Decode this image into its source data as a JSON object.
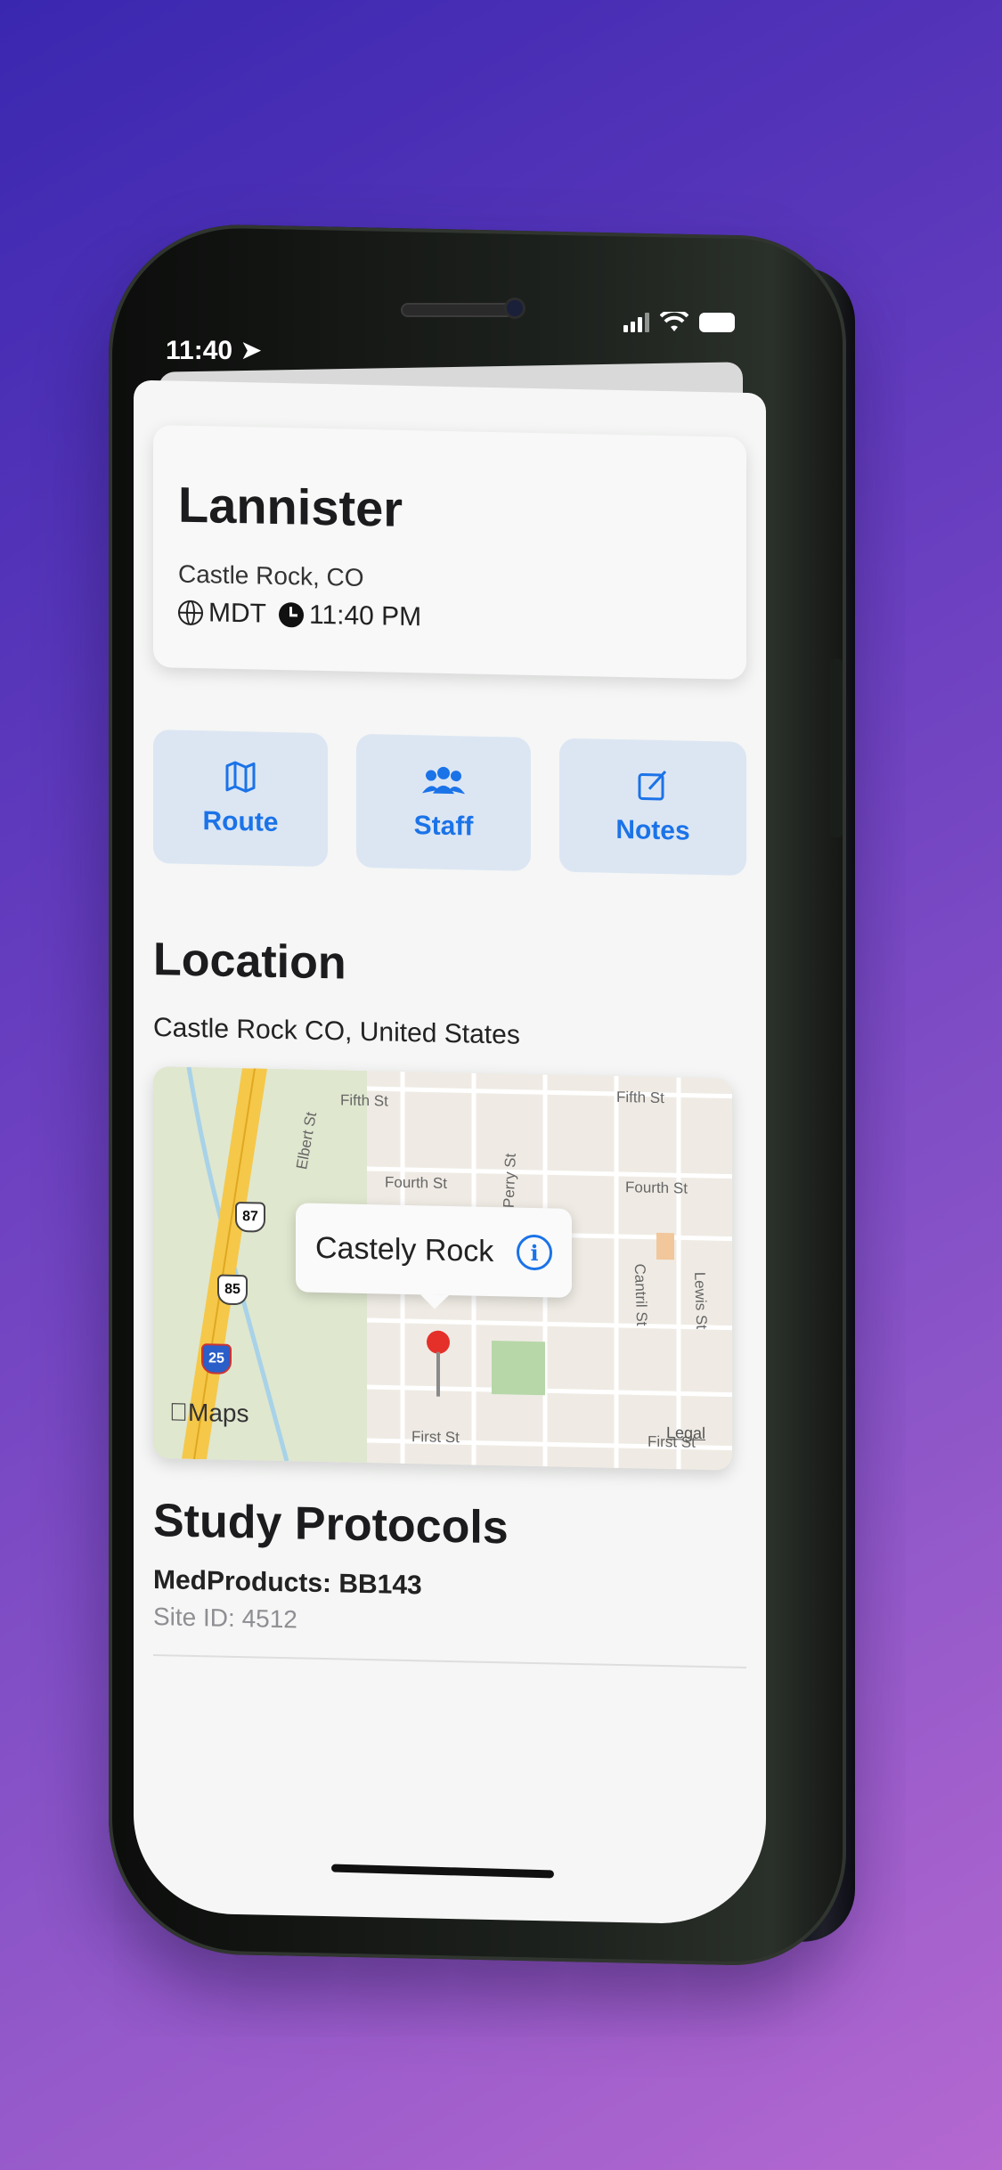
{
  "status_bar": {
    "time": "11:40"
  },
  "header": {
    "title": "Lannister",
    "city": "Castle Rock, CO",
    "timezone": "MDT",
    "local_time": "11:40 PM"
  },
  "actions": [
    {
      "label": "Route",
      "icon": "map-icon"
    },
    {
      "label": "Staff",
      "icon": "people-icon"
    },
    {
      "label": "Notes",
      "icon": "compose-icon"
    }
  ],
  "location": {
    "title": "Location",
    "address": "Castle Rock CO, United States",
    "map": {
      "callout_title": "Castely Rock",
      "brand": "Maps",
      "legal": "Legal",
      "street_labels": [
        "Fifth St",
        "Fifth St",
        "Fourth St",
        "Fourth St",
        "First St",
        "First St",
        "Elbert St",
        "Perry St",
        "Cantril St",
        "Lewis St"
      ],
      "shields": [
        "87",
        "85",
        "25"
      ]
    }
  },
  "protocols": {
    "title": "Study Protocols",
    "items": [
      {
        "name": "MedProducts: BB143",
        "site": "Site ID: 4512"
      }
    ]
  },
  "colors": {
    "accent": "#1b73e8",
    "action_bg": "#dce6f3",
    "pin": "#e5302a"
  }
}
